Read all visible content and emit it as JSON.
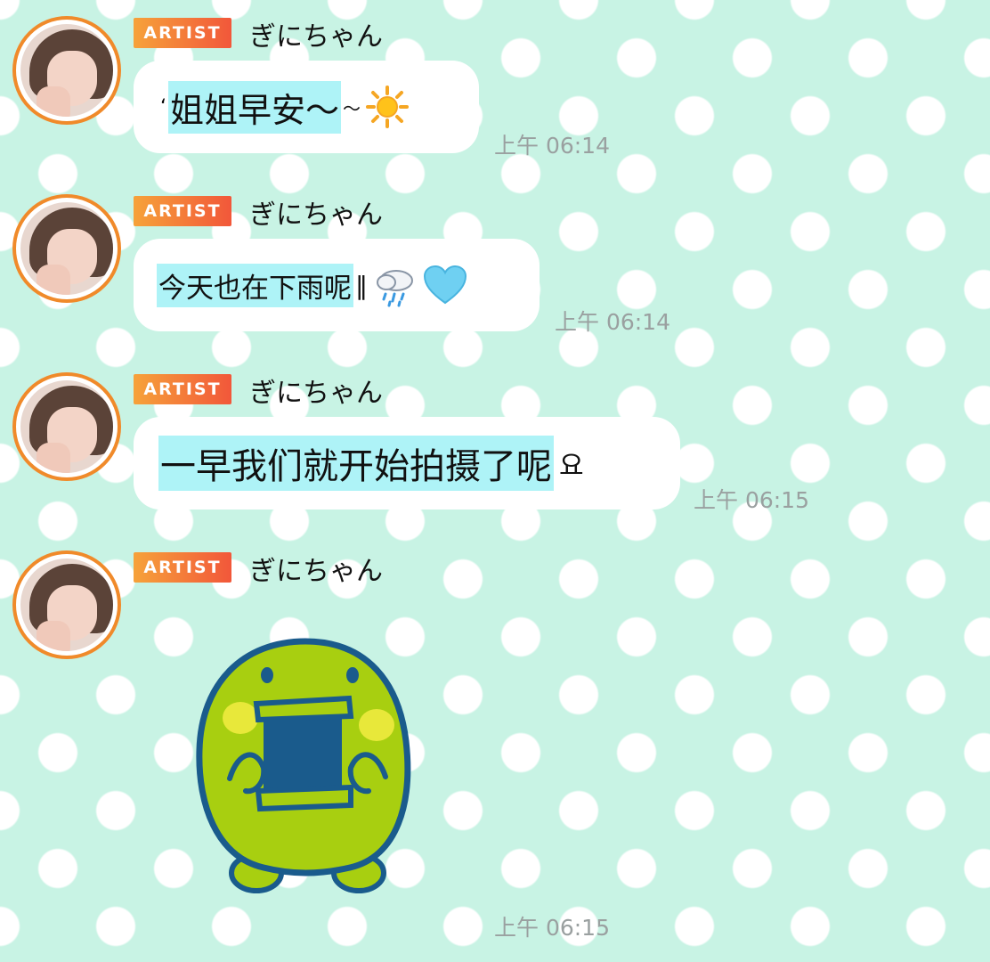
{
  "messages": [
    {
      "badge": "ARTIST",
      "name": "ぎにちゃん",
      "text": "姐姐早安〜",
      "lead": "‘",
      "trail": "～",
      "emoji_1": "sun-icon",
      "time": "上午 06:14"
    },
    {
      "badge": "ARTIST",
      "name": "ぎにちゃん",
      "text": "今天也在下雨呢",
      "trail": "‖",
      "emoji_1": "rain-cloud-icon",
      "emoji_2": "light-blue-heart-icon",
      "time": "上午 06:14"
    },
    {
      "badge": "ARTIST",
      "name": "ぎにちゃん",
      "text": "一早我们就开始拍摄了呢",
      "trail": "요",
      "time": "上午 06:15"
    },
    {
      "badge": "ARTIST",
      "name": "ぎにちゃん",
      "sticker": "green-creature-holding-notebook-sticker",
      "time": "上午 06:15"
    }
  ],
  "colors": {
    "badge_start": "#f6a23a",
    "badge_end": "#f2573a",
    "avatar_ring": "#f08a2a",
    "text_highlight": "#aef3f7",
    "background": "#c8f3e4",
    "sticker_green": "#a8cf10",
    "sticker_outline": "#1a5b8c"
  }
}
